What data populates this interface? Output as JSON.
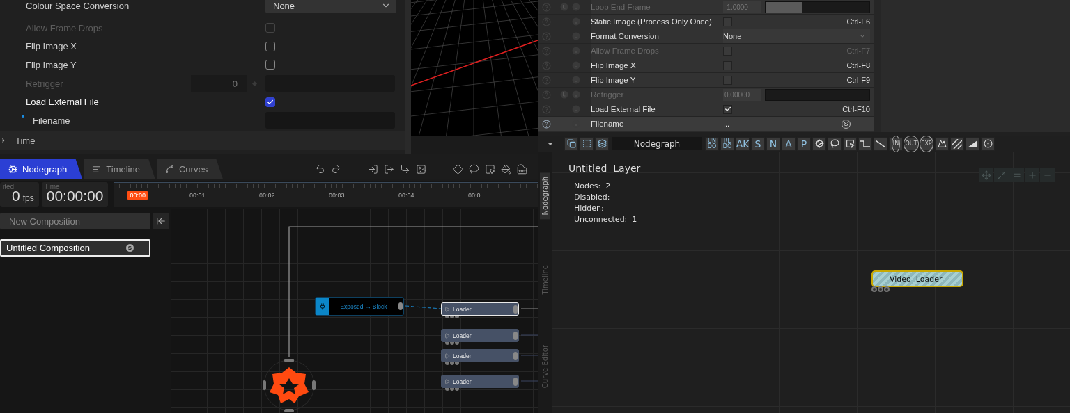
{
  "inspector": {
    "rows": [
      {
        "kind": "select",
        "label": "Colour Space Conversion",
        "value": "None",
        "disabled": false
      },
      {
        "kind": "checkbox",
        "label": "Allow Frame Drops",
        "checked": false,
        "disabled": true
      },
      {
        "kind": "checkbox",
        "label": "Flip Image X",
        "checked": false,
        "disabled": false
      },
      {
        "kind": "checkbox",
        "label": "Flip Image Y",
        "checked": false,
        "disabled": false
      },
      {
        "kind": "number",
        "label": "Retrigger",
        "value": "0",
        "disabled": true
      },
      {
        "kind": "checkbox",
        "label": "Load External File",
        "checked": true,
        "disabled": false
      },
      {
        "kind": "file",
        "label": "Filename",
        "disabled": false
      }
    ],
    "section": {
      "label": "Time",
      "expanded": false
    }
  },
  "properties": {
    "rows": [
      {
        "kind": "slider",
        "label": "Loop End Frame",
        "value": "-1.0000",
        "level": 0.35,
        "keyable": true,
        "disabled": true,
        "selected": false
      },
      {
        "kind": "checkbox",
        "label": "Static Image (Process Only Once)",
        "checked": false,
        "shortcut": "Ctrl-F6",
        "keyable": false,
        "disabled": false,
        "selected": false
      },
      {
        "kind": "select",
        "label": "Format Conversion",
        "value": "None",
        "keyable": false,
        "disabled": false,
        "selected": false
      },
      {
        "kind": "checkbox",
        "label": "Allow Frame Drops",
        "checked": false,
        "shortcut": "Ctrl-F7",
        "keyable": false,
        "disabled": true,
        "selected": false
      },
      {
        "kind": "checkbox",
        "label": "Flip Image X",
        "checked": false,
        "shortcut": "Ctrl-F8",
        "keyable": false,
        "disabled": false,
        "selected": false
      },
      {
        "kind": "checkbox",
        "label": "Flip Image Y",
        "checked": false,
        "shortcut": "Ctrl-F9",
        "keyable": false,
        "disabled": false,
        "selected": false
      },
      {
        "kind": "number",
        "label": "Retrigger",
        "value": "0.00000",
        "keyable": true,
        "disabled": true,
        "selected": false
      },
      {
        "kind": "checkbox",
        "label": "Load External File",
        "checked": true,
        "shortcut": "Ctrl-F10",
        "keyable": false,
        "disabled": false,
        "selected": false
      },
      {
        "kind": "file",
        "label": "Filename",
        "value": "...",
        "badge": "S",
        "keyable": false,
        "disabled": false,
        "selected": true
      }
    ]
  },
  "editor": {
    "tabs": [
      {
        "label": "Nodegraph",
        "selected": true
      },
      {
        "label": "Timeline",
        "selected": false
      },
      {
        "label": "Curves",
        "selected": false
      }
    ],
    "fps": {
      "label": "ited",
      "value": "0",
      "unit": "fps"
    },
    "time": {
      "label": "Time",
      "value": "00:00:00"
    },
    "ruler": {
      "playhead": "00:00",
      "ticks": [
        "00:01",
        "00:02",
        "00:03",
        "00:04",
        "00:0"
      ]
    },
    "new_button": "New Composition",
    "compositions": [
      {
        "name": "Untitled Composition",
        "badge": "S",
        "selected": true
      }
    ],
    "nodes": [
      {
        "kind": "exposed",
        "label": "Exposed → Block",
        "selected": false
      },
      {
        "kind": "loader",
        "label": "Loader",
        "selected": true
      },
      {
        "kind": "loader",
        "label": "Loader",
        "selected": false
      },
      {
        "kind": "loader",
        "label": "Loader",
        "selected": false
      },
      {
        "kind": "loader",
        "label": "Loader",
        "selected": false
      }
    ]
  },
  "nodegraph": {
    "title": "Nodegraph",
    "toolbar_text": [
      "UN DO",
      "RE DO",
      "AK",
      "S",
      "N",
      "A",
      "P"
    ],
    "toolbar_circled": [
      "IN",
      "OUT",
      "EXP"
    ],
    "side_tabs": [
      {
        "label": "Nodegraph",
        "selected": true
      },
      {
        "label": "Timeline",
        "selected": false
      },
      {
        "label": "Curve Editor",
        "selected": false
      }
    ],
    "layer": {
      "title": "Untitled  Layer",
      "stats": [
        "Nodes:  2",
        "Disabled:",
        "Hidden:",
        "Unconnected:  1"
      ]
    },
    "node": {
      "label": "Video  Loader",
      "selected": true
    }
  }
}
